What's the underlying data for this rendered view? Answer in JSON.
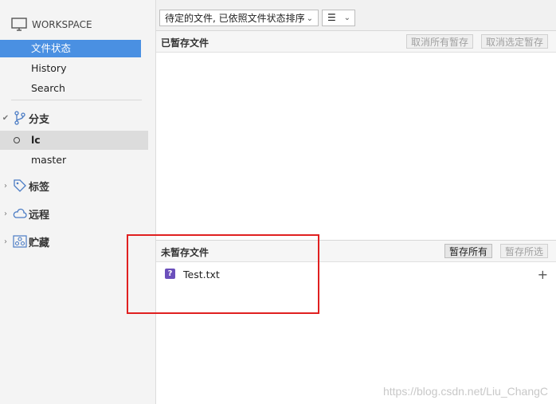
{
  "sidebar": {
    "workspace_label": "WORKSPACE",
    "nav": [
      "文件状态",
      "History",
      "Search"
    ],
    "branches_label": "分支",
    "branches": [
      "lc",
      "master"
    ],
    "tags_label": "标签",
    "remotes_label": "远程",
    "stashes_label": "贮藏"
  },
  "toolbar": {
    "sort_label": "待定的文件, 已依照文件状态排序",
    "view_label": "☰"
  },
  "staged": {
    "title": "已暂存文件",
    "unstage_all": "取消所有暂存",
    "unstage_selected": "取消选定暂存"
  },
  "unstaged": {
    "title": "未暂存文件",
    "stage_all": "暂存所有",
    "stage_selected": "暂存所选",
    "files": [
      {
        "name": "Test.txt",
        "status": "?"
      }
    ]
  },
  "watermark": "https://blog.csdn.net/Liu_ChangC",
  "colors": {
    "selection": "#4a90e2",
    "untracked": "#6b4fbb",
    "highlight_box": "#e02020"
  }
}
